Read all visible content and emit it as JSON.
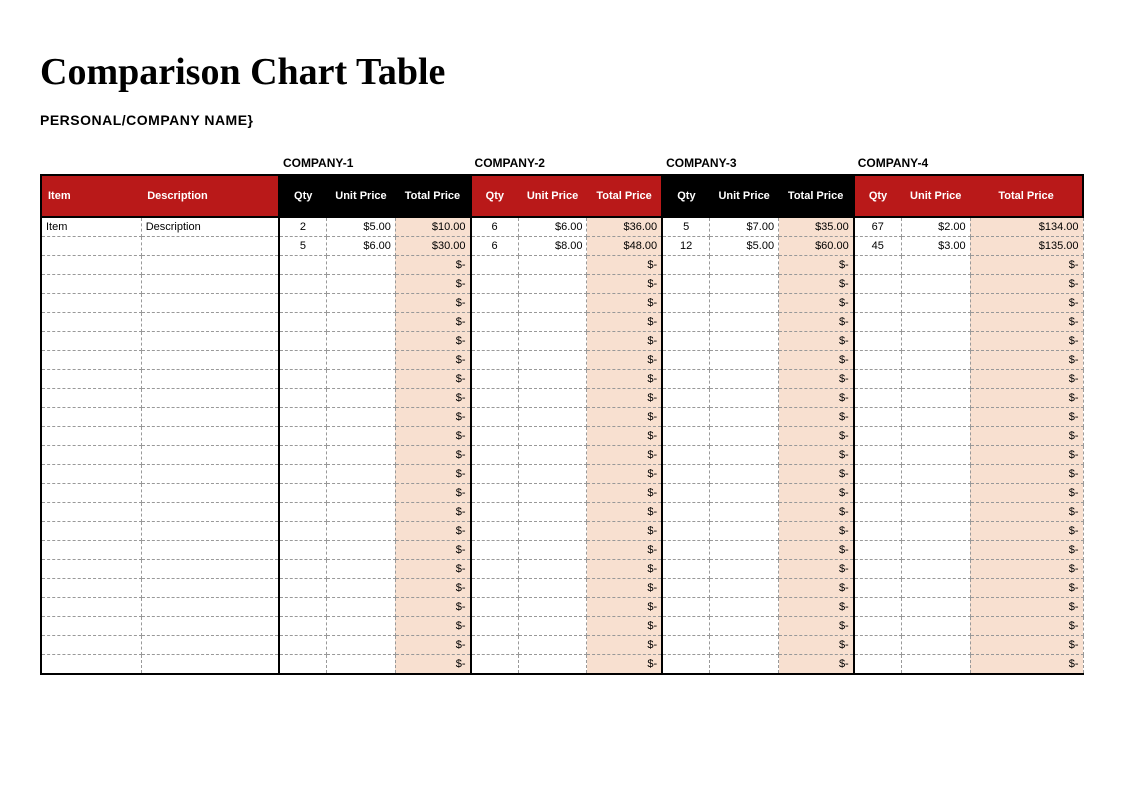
{
  "title": "Comparison Chart Table",
  "subtitle": "PERSONAL/COMPANY NAME}",
  "headers": {
    "item": "Item",
    "description": "Description",
    "qty": "Qty",
    "unit_price": "Unit Price",
    "total_price": "Total Price"
  },
  "companies": [
    "COMPANY-1",
    "COMPANY-2",
    "COMPANY-3",
    "COMPANY-4"
  ],
  "empty_total": "$-",
  "rows": [
    {
      "item": "Item",
      "description": "Description",
      "c": [
        {
          "qty": "2",
          "unit": "$5.00",
          "total": "$10.00"
        },
        {
          "qty": "6",
          "unit": "$6.00",
          "total": "$36.00"
        },
        {
          "qty": "5",
          "unit": "$7.00",
          "total": "$35.00"
        },
        {
          "qty": "67",
          "unit": "$2.00",
          "total": "$134.00"
        }
      ]
    },
    {
      "item": "",
      "description": "",
      "c": [
        {
          "qty": "5",
          "unit": "$6.00",
          "total": "$30.00"
        },
        {
          "qty": "6",
          "unit": "$8.00",
          "total": "$48.00"
        },
        {
          "qty": "12",
          "unit": "$5.00",
          "total": "$60.00"
        },
        {
          "qty": "45",
          "unit": "$3.00",
          "total": "$135.00"
        }
      ]
    }
  ],
  "empty_rows": 22,
  "chart_data": {
    "type": "table",
    "title": "Comparison Chart Table",
    "columns": [
      "Item",
      "Description",
      "C1 Qty",
      "C1 Unit",
      "C1 Total",
      "C2 Qty",
      "C2 Unit",
      "C2 Total",
      "C3 Qty",
      "C3 Unit",
      "C3 Total",
      "C4 Qty",
      "C4 Unit",
      "C4 Total"
    ],
    "rows": [
      [
        "Item",
        "Description",
        2,
        5.0,
        10.0,
        6,
        6.0,
        36.0,
        5,
        7.0,
        35.0,
        67,
        2.0,
        134.0
      ],
      [
        "",
        "",
        5,
        6.0,
        30.0,
        6,
        8.0,
        48.0,
        12,
        5.0,
        60.0,
        45,
        3.0,
        135.0
      ]
    ]
  }
}
